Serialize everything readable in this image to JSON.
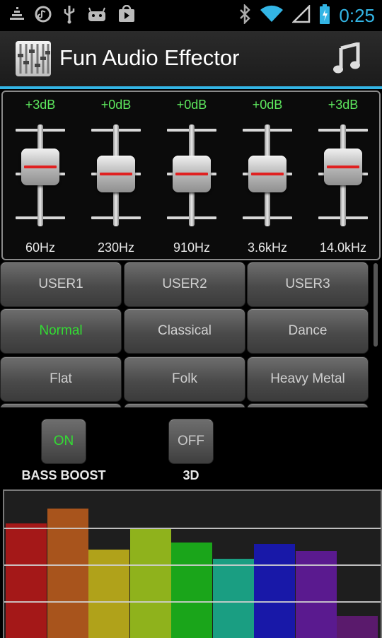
{
  "status_bar": {
    "left_icons": [
      "signal-bars-icon",
      "circle-icon",
      "usb-icon",
      "android-icon",
      "store-icon"
    ],
    "right_icons": [
      "bluetooth-icon",
      "wifi-icon",
      "cell-signal-icon",
      "battery-icon"
    ],
    "time": "0:25",
    "accent": "#33b5e5"
  },
  "action_bar": {
    "title": "Fun Audio Effector",
    "app_icon": "equalizer-app-icon",
    "action_icon": "music-note-icon"
  },
  "equalizer": {
    "bands": [
      {
        "gain": "+3dB",
        "freq": "60Hz",
        "level": 3
      },
      {
        "gain": "+0dB",
        "freq": "230Hz",
        "level": 0
      },
      {
        "gain": "+0dB",
        "freq": "910Hz",
        "level": 0
      },
      {
        "gain": "+0dB",
        "freq": "3.6kHz",
        "level": 0
      },
      {
        "gain": "+3dB",
        "freq": "14.0kHz",
        "level": 3
      }
    ],
    "gain_color": "#5ee85e"
  },
  "presets": {
    "items": [
      "USER1",
      "USER2",
      "USER3",
      "Normal",
      "Classical",
      "Dance",
      "Flat",
      "Folk",
      "Heavy Metal",
      "",
      "",
      ""
    ],
    "selected": "Normal",
    "active_color": "#33dd33"
  },
  "toggles": {
    "bass_boost": {
      "state": "ON",
      "label": "BASS BOOST",
      "color": "#33dd33"
    },
    "three_d": {
      "state": "OFF",
      "label": "3D",
      "color": "#c8c8c8"
    }
  },
  "visualizer": {
    "bars": [
      {
        "level": 0.78,
        "color": "#a41818"
      },
      {
        "level": 0.88,
        "color": "#a8541c"
      },
      {
        "level": 0.6,
        "color": "#b0a21a"
      },
      {
        "level": 0.74,
        "color": "#8fb21c"
      },
      {
        "level": 0.65,
        "color": "#1aa51a"
      },
      {
        "level": 0.54,
        "color": "#1a9e82"
      },
      {
        "level": 0.64,
        "color": "#1818a8"
      },
      {
        "level": 0.59,
        "color": "#5a1a8f"
      },
      {
        "level": 0.15,
        "color": "#5a1a6c"
      }
    ]
  }
}
